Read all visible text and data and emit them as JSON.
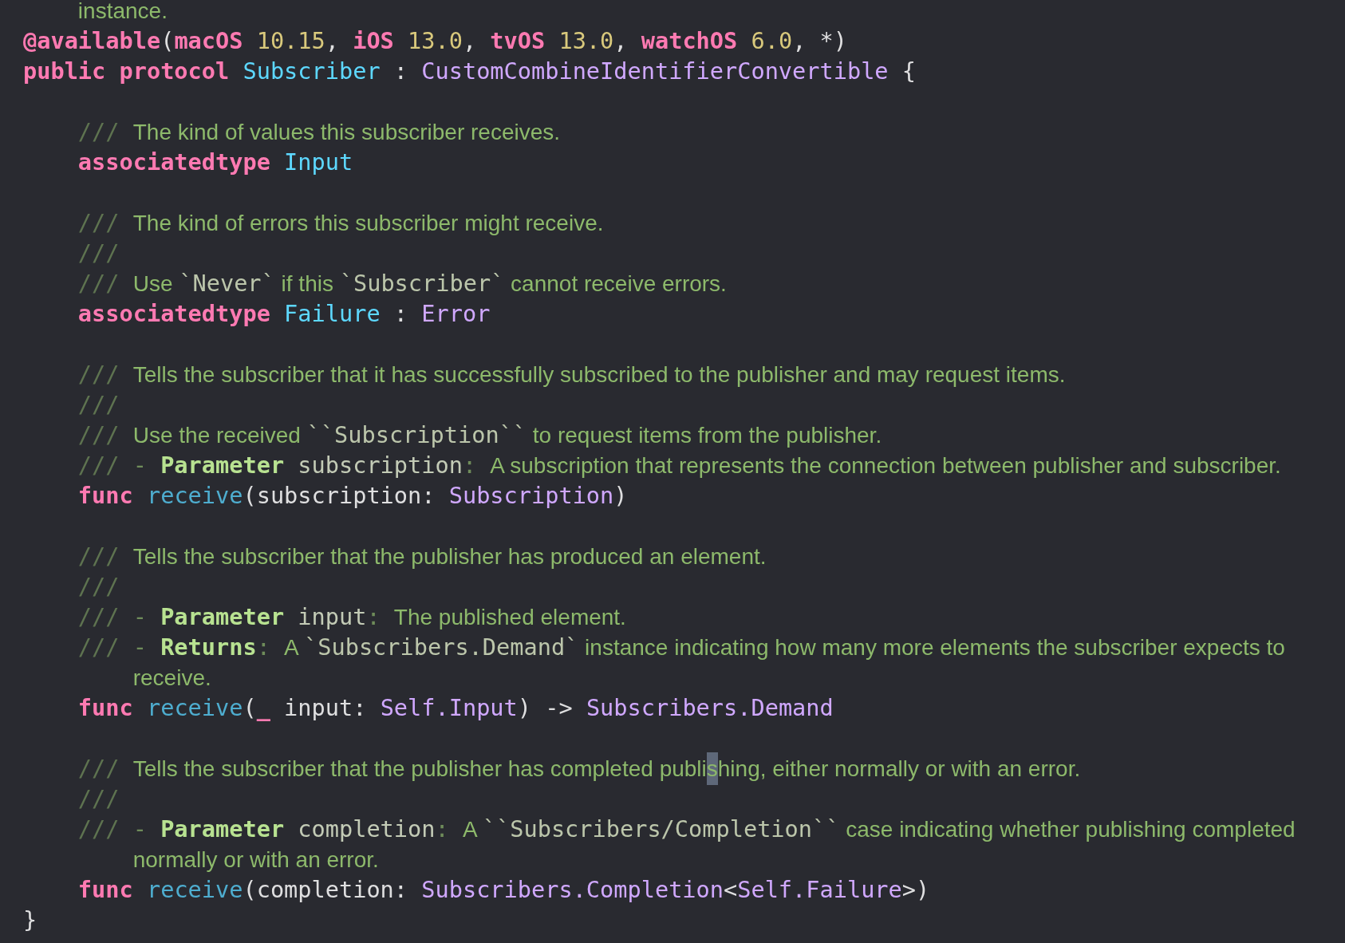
{
  "editor": {
    "lines": [
      {
        "kind": "doc_wrap",
        "tokens": [
          {
            "kind": "doc_text",
            "text": "instance."
          }
        ]
      },
      {
        "kind": "code",
        "tokens": [
          {
            "kind": "keyword",
            "text": "@available"
          },
          {
            "kind": "plain",
            "text": "("
          },
          {
            "kind": "keyword",
            "text": "macOS"
          },
          {
            "kind": "number",
            "text": " 10.15"
          },
          {
            "kind": "plain",
            "text": ", "
          },
          {
            "kind": "keyword",
            "text": "iOS"
          },
          {
            "kind": "number",
            "text": " 13.0"
          },
          {
            "kind": "plain",
            "text": ", "
          },
          {
            "kind": "keyword",
            "text": "tvOS"
          },
          {
            "kind": "number",
            "text": " 13.0"
          },
          {
            "kind": "plain",
            "text": ", "
          },
          {
            "kind": "keyword",
            "text": "watchOS"
          },
          {
            "kind": "number",
            "text": " 6.0"
          },
          {
            "kind": "plain",
            "text": ", *)"
          }
        ]
      },
      {
        "kind": "code",
        "tokens": [
          {
            "kind": "keyword",
            "text": "public protocol"
          },
          {
            "kind": "type_decl",
            "text": " Subscriber"
          },
          {
            "kind": "plain",
            "text": " : "
          },
          {
            "kind": "type",
            "text": "CustomCombineIdentifierConvertible"
          },
          {
            "kind": "plain",
            "text": " {"
          }
        ],
        "children": [
          {
            "kind": "blank"
          },
          {
            "kind": "doc",
            "marker": "///",
            "tokens": [
              {
                "kind": "doc_text",
                "text": "The kind of values this subscriber receives."
              }
            ]
          },
          {
            "kind": "code",
            "tokens": [
              {
                "kind": "keyword",
                "text": "associatedtype"
              },
              {
                "kind": "type_decl",
                "text": " Input"
              }
            ]
          },
          {
            "kind": "blank"
          },
          {
            "kind": "doc",
            "marker": "///",
            "tokens": [
              {
                "kind": "doc_text",
                "text": "The kind of errors this subscriber might receive."
              }
            ]
          },
          {
            "kind": "doc",
            "marker": "///"
          },
          {
            "kind": "doc",
            "marker": "///",
            "tokens": [
              {
                "kind": "doc_text",
                "text": "Use "
              },
              {
                "kind": "doc_code",
                "text": "`Never`"
              },
              {
                "kind": "doc_text",
                "text": " if this "
              },
              {
                "kind": "doc_code",
                "text": "`Subscriber`"
              },
              {
                "kind": "doc_text",
                "text": " cannot receive errors."
              }
            ]
          },
          {
            "kind": "code",
            "tokens": [
              {
                "kind": "keyword",
                "text": "associatedtype"
              },
              {
                "kind": "type_decl",
                "text": " Failure"
              },
              {
                "kind": "plain",
                "text": " : "
              },
              {
                "kind": "type",
                "text": "Error"
              }
            ]
          },
          {
            "kind": "blank"
          },
          {
            "kind": "doc",
            "marker": "///",
            "tokens": [
              {
                "kind": "doc_text",
                "text": "Tells the subscriber that it has successfully subscribed to the publisher and may request items."
              }
            ]
          },
          {
            "kind": "doc",
            "marker": "///"
          },
          {
            "kind": "doc",
            "marker": "///",
            "tokens": [
              {
                "kind": "doc_text",
                "text": "Use the received "
              },
              {
                "kind": "doc_code",
                "text": "``Subscription``"
              },
              {
                "kind": "doc_text",
                "text": " to request items from the publisher."
              }
            ]
          },
          {
            "kind": "doc",
            "marker": "///",
            "tokens": [
              {
                "kind": "doc_punct",
                "text": "- "
              },
              {
                "kind": "doc_keyword",
                "text": "Parameter"
              },
              {
                "kind": "doc_param",
                "text": " subscription"
              },
              {
                "kind": "doc_punct",
                "text": ": "
              },
              {
                "kind": "doc_text",
                "text": "A subscription that represents the connection between publisher and subscriber."
              }
            ]
          },
          {
            "kind": "code",
            "tokens": [
              {
                "kind": "keyword",
                "text": "func"
              },
              {
                "kind": "function",
                "text": " receive"
              },
              {
                "kind": "plain",
                "text": "(subscription: "
              },
              {
                "kind": "type",
                "text": "Subscription"
              },
              {
                "kind": "plain",
                "text": ")"
              }
            ]
          },
          {
            "kind": "blank"
          },
          {
            "kind": "doc",
            "marker": "///",
            "tokens": [
              {
                "kind": "doc_text",
                "text": "Tells the subscriber that the publisher has produced an element."
              }
            ]
          },
          {
            "kind": "doc",
            "marker": "///"
          },
          {
            "kind": "doc",
            "marker": "///",
            "tokens": [
              {
                "kind": "doc_punct",
                "text": "- "
              },
              {
                "kind": "doc_keyword",
                "text": "Parameter"
              },
              {
                "kind": "doc_param",
                "text": " input"
              },
              {
                "kind": "doc_punct",
                "text": ": "
              },
              {
                "kind": "doc_text",
                "text": "The published element."
              }
            ]
          },
          {
            "kind": "doc",
            "marker": "///",
            "tokens": [
              {
                "kind": "doc_punct",
                "text": "- "
              },
              {
                "kind": "doc_keyword",
                "text": "Returns"
              },
              {
                "kind": "doc_punct",
                "text": ": "
              },
              {
                "kind": "doc_text",
                "text": "A "
              },
              {
                "kind": "doc_code",
                "text": "`Subscribers.Demand`"
              },
              {
                "kind": "doc_text",
                "text": " instance indicating how many more elements the subscriber expects to receive."
              }
            ]
          },
          {
            "kind": "code",
            "tokens": [
              {
                "kind": "keyword",
                "text": "func"
              },
              {
                "kind": "function",
                "text": " receive"
              },
              {
                "kind": "plain",
                "text": "("
              },
              {
                "kind": "keyword",
                "text": "_"
              },
              {
                "kind": "plain",
                "text": " input: "
              },
              {
                "kind": "type",
                "text": "Self.Input"
              },
              {
                "kind": "plain",
                "text": ") -> "
              },
              {
                "kind": "type",
                "text": "Subscribers.Demand"
              }
            ]
          },
          {
            "kind": "blank"
          },
          {
            "kind": "doc",
            "marker": "///",
            "tokens": [
              {
                "kind": "doc_text",
                "text": "Tells the subscriber that the publisher has completed publi",
                "selected": false
              },
              {
                "kind": "doc_text",
                "text": "s",
                "selected": true
              },
              {
                "kind": "doc_text",
                "text": "hing, either normally or with an error.",
                "selected": false
              }
            ]
          },
          {
            "kind": "doc",
            "marker": "///"
          },
          {
            "kind": "doc",
            "marker": "///",
            "tokens": [
              {
                "kind": "doc_punct",
                "text": "- "
              },
              {
                "kind": "doc_keyword",
                "text": "Parameter"
              },
              {
                "kind": "doc_param",
                "text": " completion"
              },
              {
                "kind": "doc_punct",
                "text": ": "
              },
              {
                "kind": "doc_text",
                "text": "A "
              },
              {
                "kind": "doc_code",
                "text": "``Subscribers/Completion``"
              },
              {
                "kind": "doc_text",
                "text": " case indicating whether publishing completed normally or with an error."
              }
            ]
          },
          {
            "kind": "code",
            "tokens": [
              {
                "kind": "keyword",
                "text": "func"
              },
              {
                "kind": "function",
                "text": " receive"
              },
              {
                "kind": "plain",
                "text": "(completion: "
              },
              {
                "kind": "type",
                "text": "Subscribers.Completion"
              },
              {
                "kind": "plain",
                "text": "<"
              },
              {
                "kind": "type",
                "text": "Self.Failure"
              },
              {
                "kind": "plain",
                "text": ">)"
              }
            ]
          }
        ]
      },
      {
        "kind": "code",
        "tokens": [
          {
            "kind": "plain",
            "text": "}"
          }
        ]
      }
    ]
  }
}
